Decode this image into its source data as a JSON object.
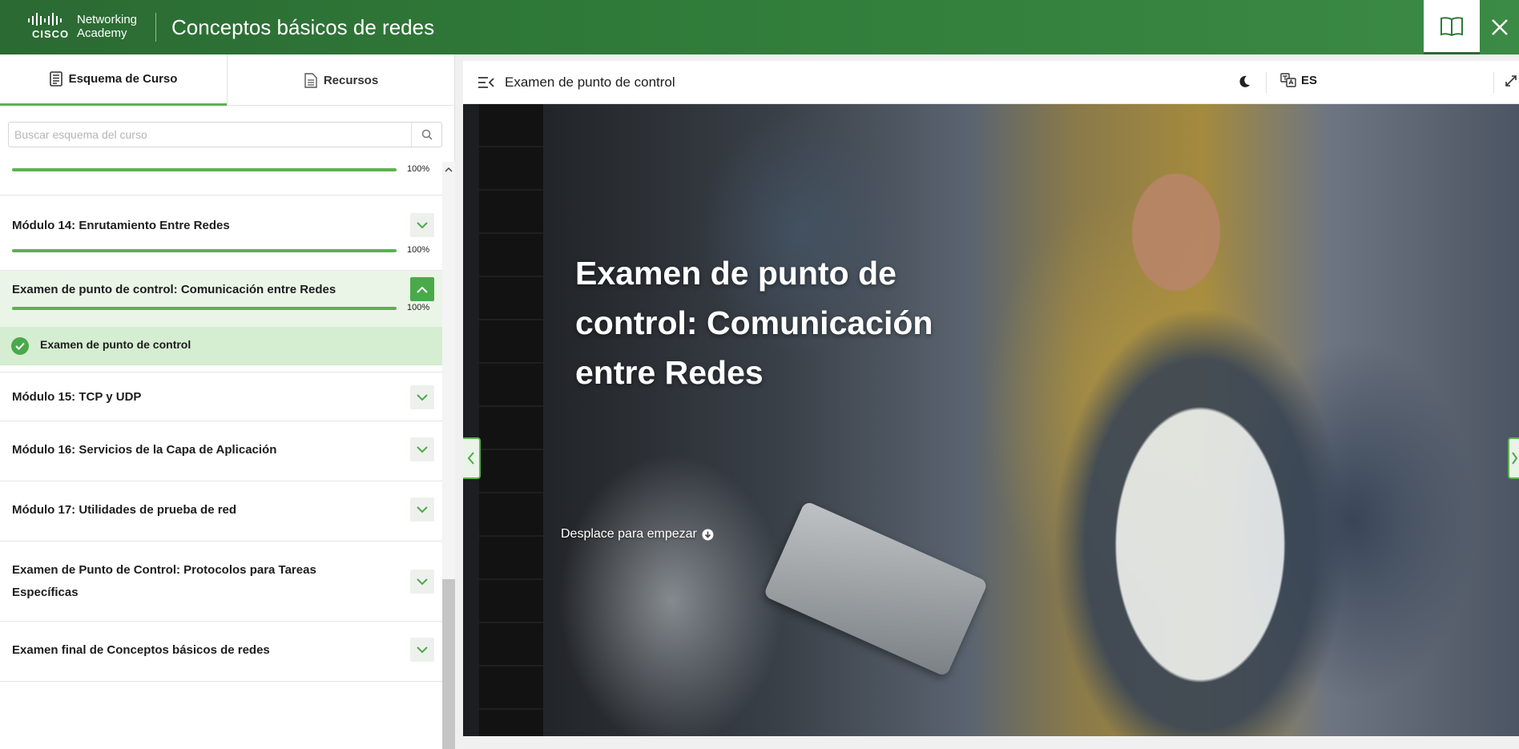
{
  "header": {
    "brand_line1": "Networking",
    "brand_line2": "Academy",
    "brand_wordmark": "CISCO",
    "course_title": "Conceptos básicos de redes",
    "book_icon": "book-open-icon",
    "close_icon": "close-icon"
  },
  "sidebar": {
    "tabs": [
      {
        "label": "Esquema de Curso",
        "icon": "document-list-icon",
        "active": true
      },
      {
        "label": "Recursos",
        "icon": "document-icon",
        "active": false
      }
    ],
    "search": {
      "placeholder": "Buscar esquema del curso",
      "value": "",
      "icon": "search-icon"
    },
    "top_progress_pct": "100%",
    "modules": [
      {
        "title": "Módulo 14: Enrutamiento Entre Redes",
        "progress": "100%",
        "expanded": false
      },
      {
        "title": "Examen de punto de control: Comunicación entre Redes",
        "progress": "100%",
        "expanded": true
      },
      {
        "title": "Módulo 15: TCP y UDP",
        "expanded": false
      },
      {
        "title": "Módulo 16: Servicios de la Capa de Aplicación",
        "expanded": false
      },
      {
        "title": "Módulo 17: Utilidades de prueba de red",
        "expanded": false
      },
      {
        "title_line1": "Examen de Punto de Control: Protocolos para Tareas",
        "title_line2": "Específicas",
        "expanded": false
      },
      {
        "title": "Examen final de Conceptos básicos de redes",
        "expanded": false
      }
    ],
    "active_item": {
      "label": "Examen de punto de control",
      "status": "completed"
    },
    "progress_value": 1.0
  },
  "content": {
    "toolbar": {
      "title": "Examen de punto de control",
      "language": "ES",
      "icons": [
        "menu-collapse-icon",
        "moon-icon",
        "translate-icon",
        "expand-icon"
      ]
    },
    "hero": {
      "title": "Examen de punto de control: Comunicación entre Redes",
      "scroll_hint": "Desplace para empezar"
    }
  },
  "colors": {
    "header_green": "#2f7a38",
    "accent_green": "#5bb24f",
    "active_bg": "#d5edd1"
  }
}
